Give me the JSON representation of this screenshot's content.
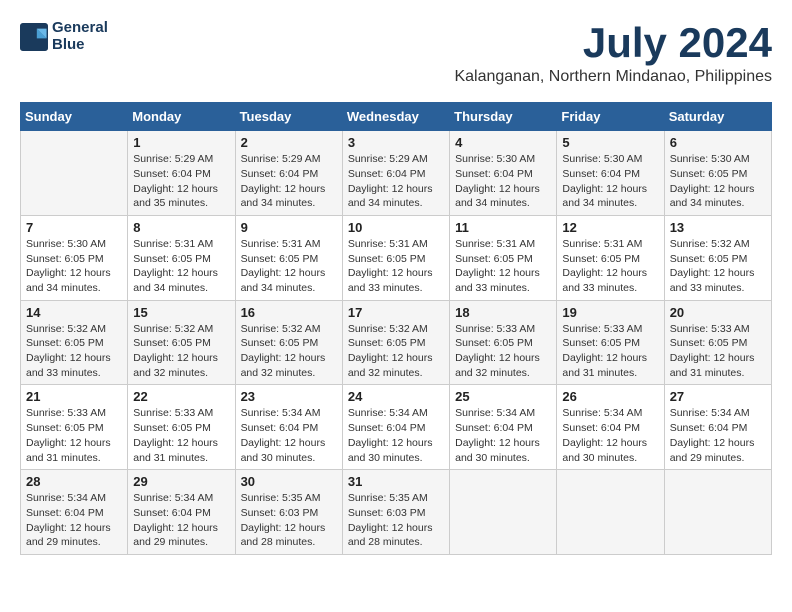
{
  "logo": {
    "name": "GeneralBlue",
    "line1": "General",
    "line2": "Blue"
  },
  "title": {
    "month_year": "July 2024",
    "location": "Kalanganan, Northern Mindanao, Philippines"
  },
  "days_of_week": [
    "Sunday",
    "Monday",
    "Tuesday",
    "Wednesday",
    "Thursday",
    "Friday",
    "Saturday"
  ],
  "weeks": [
    [
      {
        "day": "",
        "info": ""
      },
      {
        "day": "1",
        "info": "Sunrise: 5:29 AM\nSunset: 6:04 PM\nDaylight: 12 hours\nand 35 minutes."
      },
      {
        "day": "2",
        "info": "Sunrise: 5:29 AM\nSunset: 6:04 PM\nDaylight: 12 hours\nand 34 minutes."
      },
      {
        "day": "3",
        "info": "Sunrise: 5:29 AM\nSunset: 6:04 PM\nDaylight: 12 hours\nand 34 minutes."
      },
      {
        "day": "4",
        "info": "Sunrise: 5:30 AM\nSunset: 6:04 PM\nDaylight: 12 hours\nand 34 minutes."
      },
      {
        "day": "5",
        "info": "Sunrise: 5:30 AM\nSunset: 6:04 PM\nDaylight: 12 hours\nand 34 minutes."
      },
      {
        "day": "6",
        "info": "Sunrise: 5:30 AM\nSunset: 6:05 PM\nDaylight: 12 hours\nand 34 minutes."
      }
    ],
    [
      {
        "day": "7",
        "info": "Sunrise: 5:30 AM\nSunset: 6:05 PM\nDaylight: 12 hours\nand 34 minutes."
      },
      {
        "day": "8",
        "info": "Sunrise: 5:31 AM\nSunset: 6:05 PM\nDaylight: 12 hours\nand 34 minutes."
      },
      {
        "day": "9",
        "info": "Sunrise: 5:31 AM\nSunset: 6:05 PM\nDaylight: 12 hours\nand 34 minutes."
      },
      {
        "day": "10",
        "info": "Sunrise: 5:31 AM\nSunset: 6:05 PM\nDaylight: 12 hours\nand 33 minutes."
      },
      {
        "day": "11",
        "info": "Sunrise: 5:31 AM\nSunset: 6:05 PM\nDaylight: 12 hours\nand 33 minutes."
      },
      {
        "day": "12",
        "info": "Sunrise: 5:31 AM\nSunset: 6:05 PM\nDaylight: 12 hours\nand 33 minutes."
      },
      {
        "day": "13",
        "info": "Sunrise: 5:32 AM\nSunset: 6:05 PM\nDaylight: 12 hours\nand 33 minutes."
      }
    ],
    [
      {
        "day": "14",
        "info": "Sunrise: 5:32 AM\nSunset: 6:05 PM\nDaylight: 12 hours\nand 33 minutes."
      },
      {
        "day": "15",
        "info": "Sunrise: 5:32 AM\nSunset: 6:05 PM\nDaylight: 12 hours\nand 32 minutes."
      },
      {
        "day": "16",
        "info": "Sunrise: 5:32 AM\nSunset: 6:05 PM\nDaylight: 12 hours\nand 32 minutes."
      },
      {
        "day": "17",
        "info": "Sunrise: 5:32 AM\nSunset: 6:05 PM\nDaylight: 12 hours\nand 32 minutes."
      },
      {
        "day": "18",
        "info": "Sunrise: 5:33 AM\nSunset: 6:05 PM\nDaylight: 12 hours\nand 32 minutes."
      },
      {
        "day": "19",
        "info": "Sunrise: 5:33 AM\nSunset: 6:05 PM\nDaylight: 12 hours\nand 31 minutes."
      },
      {
        "day": "20",
        "info": "Sunrise: 5:33 AM\nSunset: 6:05 PM\nDaylight: 12 hours\nand 31 minutes."
      }
    ],
    [
      {
        "day": "21",
        "info": "Sunrise: 5:33 AM\nSunset: 6:05 PM\nDaylight: 12 hours\nand 31 minutes."
      },
      {
        "day": "22",
        "info": "Sunrise: 5:33 AM\nSunset: 6:05 PM\nDaylight: 12 hours\nand 31 minutes."
      },
      {
        "day": "23",
        "info": "Sunrise: 5:34 AM\nSunset: 6:04 PM\nDaylight: 12 hours\nand 30 minutes."
      },
      {
        "day": "24",
        "info": "Sunrise: 5:34 AM\nSunset: 6:04 PM\nDaylight: 12 hours\nand 30 minutes."
      },
      {
        "day": "25",
        "info": "Sunrise: 5:34 AM\nSunset: 6:04 PM\nDaylight: 12 hours\nand 30 minutes."
      },
      {
        "day": "26",
        "info": "Sunrise: 5:34 AM\nSunset: 6:04 PM\nDaylight: 12 hours\nand 30 minutes."
      },
      {
        "day": "27",
        "info": "Sunrise: 5:34 AM\nSunset: 6:04 PM\nDaylight: 12 hours\nand 29 minutes."
      }
    ],
    [
      {
        "day": "28",
        "info": "Sunrise: 5:34 AM\nSunset: 6:04 PM\nDaylight: 12 hours\nand 29 minutes."
      },
      {
        "day": "29",
        "info": "Sunrise: 5:34 AM\nSunset: 6:04 PM\nDaylight: 12 hours\nand 29 minutes."
      },
      {
        "day": "30",
        "info": "Sunrise: 5:35 AM\nSunset: 6:03 PM\nDaylight: 12 hours\nand 28 minutes."
      },
      {
        "day": "31",
        "info": "Sunrise: 5:35 AM\nSunset: 6:03 PM\nDaylight: 12 hours\nand 28 minutes."
      },
      {
        "day": "",
        "info": ""
      },
      {
        "day": "",
        "info": ""
      },
      {
        "day": "",
        "info": ""
      }
    ]
  ]
}
